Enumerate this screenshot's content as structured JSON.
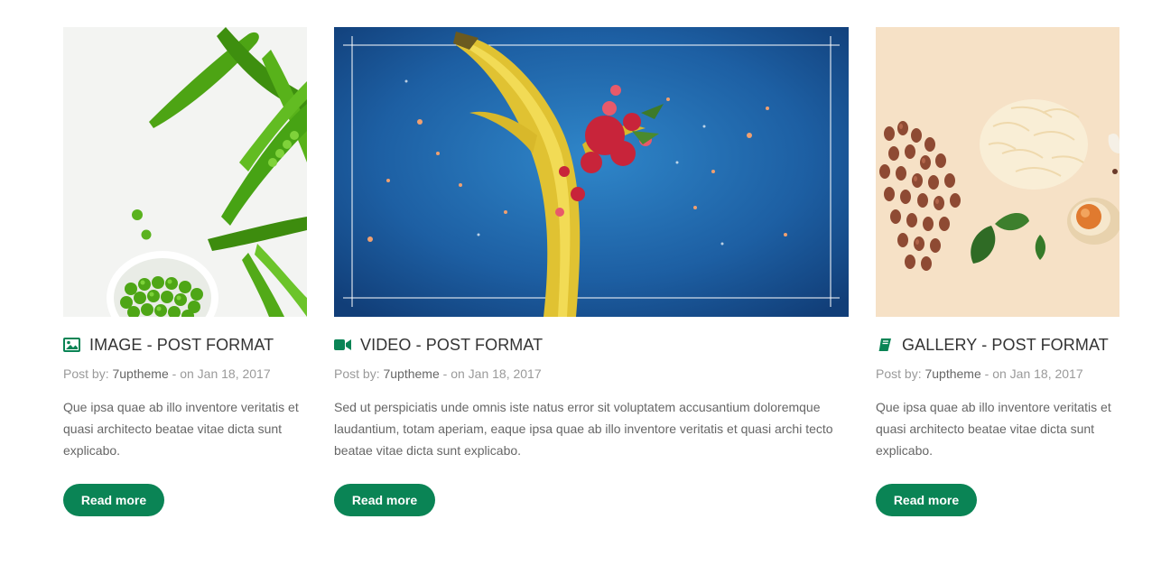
{
  "theme": {
    "accent": "#0a8455",
    "title_color": "#333333",
    "meta_color": "#9a9a9a",
    "text_color": "#666666"
  },
  "posts": [
    {
      "image_subject": "green peas and pea pods in a white bowl",
      "format_icon": "image-icon",
      "title": "IMAGE - POST FORMAT",
      "meta": {
        "prefix": "Post by:",
        "author": "7uptheme",
        "date": "- on Jan 18, 2017"
      },
      "excerpt": "Que ipsa quae ab illo inventore veritatis et quasi architecto beatae vitae dicta sunt explicabo.",
      "button": "Read more"
    },
    {
      "image_subject": "banana exploding with fruit splash on blue background",
      "format_icon": "video-camera-icon",
      "title": "VIDEO - POST FORMAT",
      "meta": {
        "prefix": "Post by:",
        "author": "7uptheme",
        "date": "- on Jan 18, 2017"
      },
      "excerpt": "Sed ut perspiciatis unde omnis iste natus error sit voluptatem accusantium doloremque laudantium, totam aperiam, eaque ipsa quae ab illo inventore veritatis et quasi archi tecto beatae vitae dicta sunt explicabo.",
      "button": "Read more"
    },
    {
      "image_subject": "peanuts, grated cheese, basil leaves and an egg on beige background",
      "format_icon": "book-icon",
      "title": "GALLERY - POST FORMAT",
      "meta": {
        "prefix": "Post by:",
        "author": "7uptheme",
        "date": "- on Jan 18, 2017"
      },
      "excerpt": "Que ipsa quae ab illo inventore veritatis et quasi architecto beatae vitae dicta sunt explicabo.",
      "button": "Read more"
    }
  ]
}
